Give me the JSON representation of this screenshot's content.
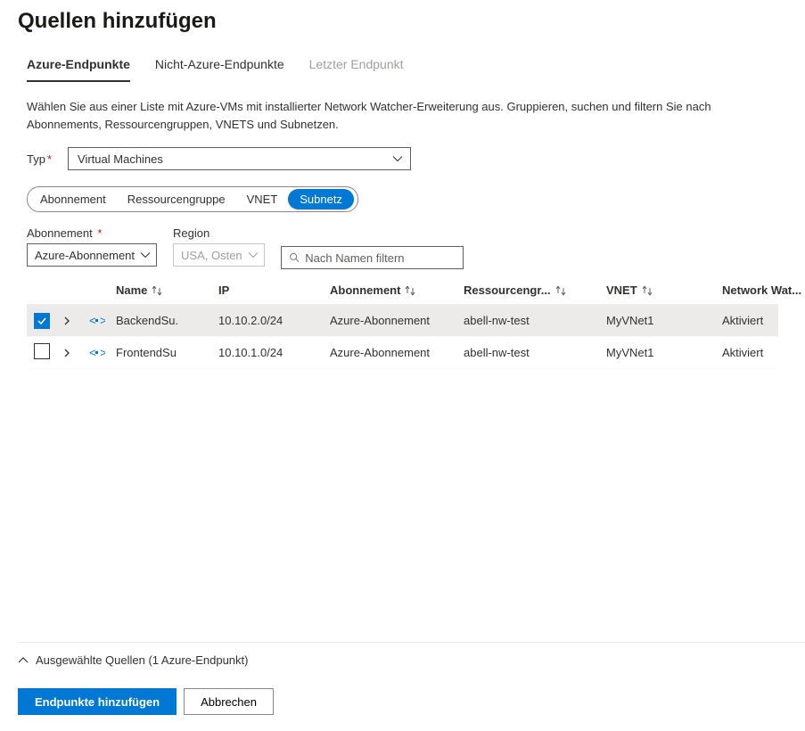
{
  "header": {
    "title": "Quellen hinzufügen"
  },
  "tabs": {
    "azure": "Azure-Endpunkte",
    "non_azure": "Nicht-Azure-Endpunkte",
    "last": "Letzter Endpunkt"
  },
  "description": "Wählen Sie aus einer Liste mit Azure-VMs mit installierter Network Watcher-Erweiterung aus. Gruppieren, suchen und filtern Sie nach Abonnements, Ressourcengruppen, VNETS und Subnetzen.",
  "type": {
    "label": "Typ",
    "value": "Virtual Machines"
  },
  "groupBy": {
    "abonnement": "Abonnement",
    "rg": "Ressourcengruppe",
    "vnet": "VNET",
    "subnetz": "Subnetz"
  },
  "filters": {
    "abonnement": {
      "label": "Abonnement",
      "value": "Azure-Abonnement"
    },
    "region": {
      "label": "Region",
      "value": "USA, Osten"
    },
    "search_placeholder": "Nach Namen filtern"
  },
  "columns": {
    "name": "Name",
    "ip": "IP",
    "abonnement": "Abonnement",
    "rg": "Ressourcengr...",
    "vnet": "VNET",
    "nw": "Network Wat..."
  },
  "rows": [
    {
      "name": "BackendSu.",
      "ip": "10.10.2.0/24",
      "abonnement": "Azure-Abonnement",
      "rg": "abell-nw-test",
      "vnet": "MyVNet1",
      "nw": "Aktiviert",
      "checked": true
    },
    {
      "name": "FrontendSu",
      "ip": "10.10.1.0/24",
      "abonnement": "Azure-Abonnement",
      "rg": "abell-nw-test",
      "vnet": "MyVNet1",
      "nw": "Aktiviert",
      "checked": false
    }
  ],
  "summary": {
    "text": "Ausgewählte Quellen (1 Azure-Endpunkt)"
  },
  "buttons": {
    "add": "Endpunkte hinzufügen",
    "cancel": "Abbrechen"
  }
}
